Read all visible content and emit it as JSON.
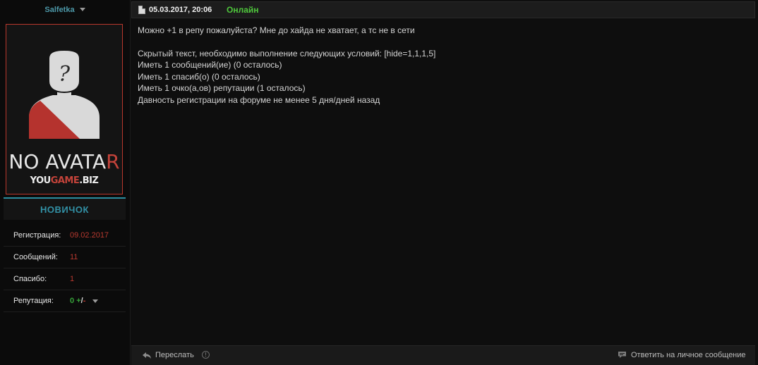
{
  "user": {
    "name": "Salfetka",
    "avatar": {
      "no_text": "NO ",
      "avatar_text_white": "AVATA",
      "avatar_text_red": "R",
      "site_white_1": "YOU",
      "site_red": "GAME",
      "site_white_2": ".BIZ",
      "border_color": "#b9372d"
    },
    "rank": "НОВИЧОК",
    "stats": {
      "registration_label": "Регистрация:",
      "registration_value": "09.02.2017",
      "messages_label": "Сообщений:",
      "messages_value": "11",
      "thanks_label": "Спасибо:",
      "thanks_value": "1",
      "reputation_label": "Репутация:",
      "reputation_value": "0",
      "reputation_plus": "+",
      "reputation_slash": "/",
      "reputation_minus": "-"
    }
  },
  "post": {
    "date": "05.03.2017, 20:06",
    "status": "Онлайн",
    "body": {
      "line1": "Можно +1 в репу пожалуйста? Мне до хайда не хватает, а тс не в сети",
      "line2": "Скрытый текст, необходимо выполнение следующих условий: [hide=1,1,1,5]",
      "line3": "Иметь 1 сообщений(ие) (0 осталось)",
      "line4": "Иметь 1 спасиб(о) (0 осталось)",
      "line5": "Иметь 1 очко(а,ов) репутации (1 осталось)",
      "line6": "Давность регистрации на форуме не менее 5 дня/дней назад"
    },
    "footer": {
      "forward_label": "Переслать",
      "info_glyph": "!",
      "pm_label": "Ответить на личное сообщение"
    }
  },
  "colors": {
    "accent_teal": "#3291a6",
    "online_green": "#4fc73c",
    "value_red": "#b8392f"
  },
  "icons": {
    "user_menu": "chevron-down-icon",
    "post_date": "document-icon",
    "forward": "reply-arrow-icon",
    "info": "info-icon",
    "pm": "chat-bubble-icon"
  }
}
